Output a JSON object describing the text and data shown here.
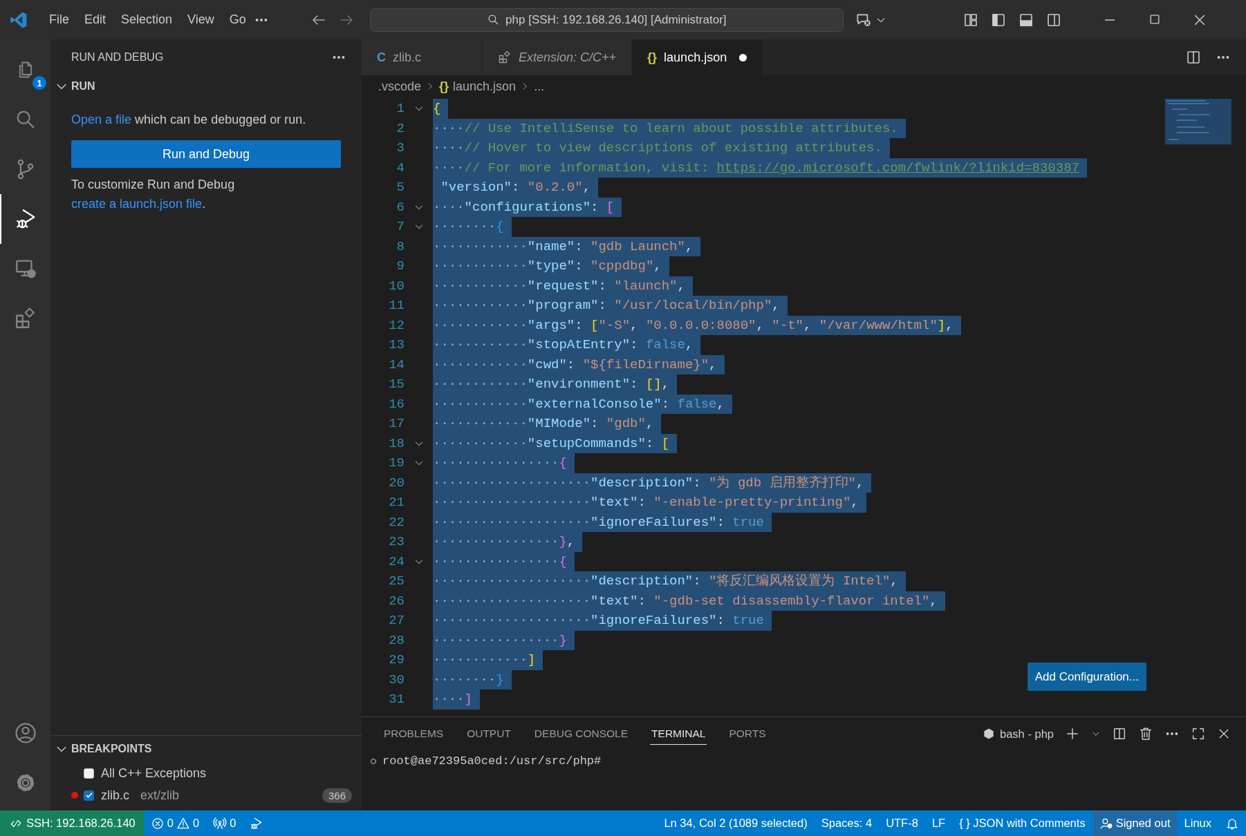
{
  "title_bar": {
    "menu": [
      "File",
      "Edit",
      "Selection",
      "View",
      "Go"
    ],
    "command_center": "php [SSH: 192.168.26.140] [Administrator]"
  },
  "activity_bar": {
    "items": [
      {
        "kind": "files",
        "badge": "1",
        "selected": false
      },
      {
        "kind": "search",
        "selected": false
      },
      {
        "kind": "source_control",
        "selected": false
      },
      {
        "kind": "run_debug",
        "selected": true
      },
      {
        "kind": "remote",
        "selected": false
      },
      {
        "kind": "extensions",
        "selected": false
      }
    ],
    "bottom": [
      {
        "kind": "account"
      },
      {
        "kind": "settings"
      }
    ]
  },
  "sidebar": {
    "title": "RUN AND DEBUG",
    "run_section": {
      "title": "RUN",
      "expanded": true,
      "intro_link": "Open a file",
      "intro_text": " which can be debugged or run.",
      "button": "Run and Debug",
      "customize_text": "To customize Run and Debug ",
      "customize_link": "create a launch.json file",
      "customize_end": "."
    },
    "breakpoints": {
      "title": "BREAKPOINTS",
      "expanded": true,
      "items": [
        {
          "kind": "exception",
          "label": "All C++ Exceptions",
          "checked": false
        },
        {
          "kind": "file",
          "label": "zlib.c",
          "path": "ext/zlib",
          "count": "366",
          "checked": true
        }
      ]
    }
  },
  "editor": {
    "tabs": [
      {
        "kind": "file",
        "glyph": "C",
        "label": "zlib.c",
        "selected": false,
        "modified": false
      },
      {
        "kind": "extension",
        "label": "Extension: C/C++",
        "selected": false,
        "modified": false
      },
      {
        "kind": "file",
        "glyph": "{}",
        "label": "launch.json",
        "selected": true,
        "modified": true
      }
    ],
    "breadcrumb": {
      "folder": ".vscode",
      "file_glyph": "{}",
      "file": "launch.json",
      "symbol": "..."
    },
    "lines": [
      {
        "n": "1",
        "fold": true,
        "selected": true,
        "tokens": [
          {
            "kind": "b1",
            "t": "{"
          }
        ]
      },
      {
        "n": "2",
        "fold": false,
        "selected": true,
        "tokens": [
          {
            "kind": "ws",
            "t": "····"
          },
          {
            "kind": "cm",
            "t": "// Use IntelliSense to learn about possible attributes."
          }
        ]
      },
      {
        "n": "3",
        "fold": false,
        "selected": true,
        "tokens": [
          {
            "kind": "ws",
            "t": "····"
          },
          {
            "kind": "cm",
            "t": "// Hover to view descriptions of existing attributes."
          }
        ]
      },
      {
        "n": "4",
        "fold": false,
        "selected": true,
        "tokens": [
          {
            "kind": "ws",
            "t": "····"
          },
          {
            "kind": "cm",
            "t": "// For more information, visit: "
          },
          {
            "kind": "link",
            "t": "https://go.microsoft.com/fwlink/?linkid=830387"
          }
        ]
      },
      {
        "n": "5",
        "fold": false,
        "selected": true,
        "tokens": [
          {
            "kind": "key",
            "t": " \"version\""
          },
          {
            "kind": "p",
            "t": ": "
          },
          {
            "kind": "str",
            "t": "\"0.2.0\""
          },
          {
            "kind": "p",
            "t": ","
          }
        ]
      },
      {
        "n": "6",
        "fold": true,
        "selected": true,
        "tokens": [
          {
            "kind": "ws",
            "t": "····"
          },
          {
            "kind": "key",
            "t": "\"configurations\""
          },
          {
            "kind": "p",
            "t": ": "
          },
          {
            "kind": "b2",
            "t": "["
          }
        ]
      },
      {
        "n": "7",
        "fold": true,
        "selected": true,
        "tokens": [
          {
            "kind": "ws",
            "t": "········"
          },
          {
            "kind": "b3",
            "t": "{"
          }
        ]
      },
      {
        "n": "8",
        "fold": false,
        "selected": true,
        "tokens": [
          {
            "kind": "ws",
            "t": "············"
          },
          {
            "kind": "key",
            "t": "\"name\""
          },
          {
            "kind": "p",
            "t": ": "
          },
          {
            "kind": "str",
            "t": "\"gdb Launch\""
          },
          {
            "kind": "p",
            "t": ","
          }
        ]
      },
      {
        "n": "9",
        "fold": false,
        "selected": true,
        "tokens": [
          {
            "kind": "ws",
            "t": "············"
          },
          {
            "kind": "key",
            "t": "\"type\""
          },
          {
            "kind": "p",
            "t": ": "
          },
          {
            "kind": "str",
            "t": "\"cppdbg\""
          },
          {
            "kind": "p",
            "t": ","
          }
        ]
      },
      {
        "n": "10",
        "fold": false,
        "selected": true,
        "tokens": [
          {
            "kind": "ws",
            "t": "············"
          },
          {
            "kind": "key",
            "t": "\"request\""
          },
          {
            "kind": "p",
            "t": ": "
          },
          {
            "kind": "str",
            "t": "\"launch\""
          },
          {
            "kind": "p",
            "t": ","
          }
        ]
      },
      {
        "n": "11",
        "fold": false,
        "selected": true,
        "tokens": [
          {
            "kind": "ws",
            "t": "············"
          },
          {
            "kind": "key",
            "t": "\"program\""
          },
          {
            "kind": "p",
            "t": ": "
          },
          {
            "kind": "str",
            "t": "\"/usr/local/bin/php\""
          },
          {
            "kind": "p",
            "t": ","
          }
        ]
      },
      {
        "n": "12",
        "fold": false,
        "selected": true,
        "tokens": [
          {
            "kind": "ws",
            "t": "············"
          },
          {
            "kind": "key",
            "t": "\"args\""
          },
          {
            "kind": "p",
            "t": ": "
          },
          {
            "kind": "b1",
            "t": "["
          },
          {
            "kind": "str",
            "t": "\"-S\""
          },
          {
            "kind": "p",
            "t": ", "
          },
          {
            "kind": "str",
            "t": "\"0.0.0.0:8080\""
          },
          {
            "kind": "p",
            "t": ", "
          },
          {
            "kind": "str",
            "t": "\"-t\""
          },
          {
            "kind": "p",
            "t": ", "
          },
          {
            "kind": "str",
            "t": "\"/var/www/html\""
          },
          {
            "kind": "b1",
            "t": "]"
          },
          {
            "kind": "p",
            "t": ","
          }
        ]
      },
      {
        "n": "13",
        "fold": false,
        "selected": true,
        "tokens": [
          {
            "kind": "ws",
            "t": "············"
          },
          {
            "kind": "key",
            "t": "\"stopAtEntry\""
          },
          {
            "kind": "p",
            "t": ": "
          },
          {
            "kind": "kw",
            "t": "false"
          },
          {
            "kind": "p",
            "t": ","
          }
        ]
      },
      {
        "n": "14",
        "fold": false,
        "selected": true,
        "tokens": [
          {
            "kind": "ws",
            "t": "············"
          },
          {
            "kind": "key",
            "t": "\"cwd\""
          },
          {
            "kind": "p",
            "t": ": "
          },
          {
            "kind": "str",
            "t": "\"${fileDirname}\""
          },
          {
            "kind": "p",
            "t": ","
          }
        ]
      },
      {
        "n": "15",
        "fold": false,
        "selected": true,
        "tokens": [
          {
            "kind": "ws",
            "t": "············"
          },
          {
            "kind": "key",
            "t": "\"environment\""
          },
          {
            "kind": "p",
            "t": ": "
          },
          {
            "kind": "b1",
            "t": "[]"
          },
          {
            "kind": "p",
            "t": ","
          }
        ]
      },
      {
        "n": "16",
        "fold": false,
        "selected": true,
        "tokens": [
          {
            "kind": "ws",
            "t": "············"
          },
          {
            "kind": "key",
            "t": "\"externalConsole\""
          },
          {
            "kind": "p",
            "t": ": "
          },
          {
            "kind": "kw",
            "t": "false"
          },
          {
            "kind": "p",
            "t": ","
          }
        ]
      },
      {
        "n": "17",
        "fold": false,
        "selected": true,
        "tokens": [
          {
            "kind": "ws",
            "t": "············"
          },
          {
            "kind": "key",
            "t": "\"MIMode\""
          },
          {
            "kind": "p",
            "t": ": "
          },
          {
            "kind": "str",
            "t": "\"gdb\""
          },
          {
            "kind": "p",
            "t": ","
          }
        ]
      },
      {
        "n": "18",
        "fold": true,
        "selected": true,
        "tokens": [
          {
            "kind": "ws",
            "t": "············"
          },
          {
            "kind": "key",
            "t": "\"setupCommands\""
          },
          {
            "kind": "p",
            "t": ": "
          },
          {
            "kind": "b1",
            "t": "["
          }
        ]
      },
      {
        "n": "19",
        "fold": true,
        "selected": true,
        "tokens": [
          {
            "kind": "ws",
            "t": "················"
          },
          {
            "kind": "b2",
            "t": "{"
          }
        ]
      },
      {
        "n": "20",
        "fold": false,
        "selected": true,
        "tokens": [
          {
            "kind": "ws",
            "t": "····················"
          },
          {
            "kind": "key",
            "t": "\"description\""
          },
          {
            "kind": "p",
            "t": ": "
          },
          {
            "kind": "str",
            "t": "\"为 gdb 启用整齐打印\""
          },
          {
            "kind": "p",
            "t": ","
          }
        ]
      },
      {
        "n": "21",
        "fold": false,
        "selected": true,
        "tokens": [
          {
            "kind": "ws",
            "t": "····················"
          },
          {
            "kind": "key",
            "t": "\"text\""
          },
          {
            "kind": "p",
            "t": ": "
          },
          {
            "kind": "str",
            "t": "\"-enable-pretty-printing\""
          },
          {
            "kind": "p",
            "t": ","
          }
        ]
      },
      {
        "n": "22",
        "fold": false,
        "selected": true,
        "tokens": [
          {
            "kind": "ws",
            "t": "····················"
          },
          {
            "kind": "key",
            "t": "\"ignoreFailures\""
          },
          {
            "kind": "p",
            "t": ": "
          },
          {
            "kind": "kw",
            "t": "true"
          }
        ]
      },
      {
        "n": "23",
        "fold": false,
        "selected": true,
        "tokens": [
          {
            "kind": "ws",
            "t": "················"
          },
          {
            "kind": "b2",
            "t": "}"
          },
          {
            "kind": "p",
            "t": ","
          }
        ]
      },
      {
        "n": "24",
        "fold": true,
        "selected": true,
        "tokens": [
          {
            "kind": "ws",
            "t": "················"
          },
          {
            "kind": "b2",
            "t": "{"
          }
        ]
      },
      {
        "n": "25",
        "fold": false,
        "selected": true,
        "tokens": [
          {
            "kind": "ws",
            "t": "····················"
          },
          {
            "kind": "key",
            "t": "\"description\""
          },
          {
            "kind": "p",
            "t": ": "
          },
          {
            "kind": "str",
            "t": "\"将反汇编风格设置为 Intel\""
          },
          {
            "kind": "p",
            "t": ","
          }
        ]
      },
      {
        "n": "26",
        "fold": false,
        "selected": true,
        "tokens": [
          {
            "kind": "ws",
            "t": "····················"
          },
          {
            "kind": "key",
            "t": "\"text\""
          },
          {
            "kind": "p",
            "t": ": "
          },
          {
            "kind": "str",
            "t": "\"-gdb-set disassembly-flavor intel\""
          },
          {
            "kind": "p",
            "t": ","
          }
        ]
      },
      {
        "n": "27",
        "fold": false,
        "selected": true,
        "tokens": [
          {
            "kind": "ws",
            "t": "····················"
          },
          {
            "kind": "key",
            "t": "\"ignoreFailures\""
          },
          {
            "kind": "p",
            "t": ": "
          },
          {
            "kind": "kw",
            "t": "true"
          }
        ]
      },
      {
        "n": "28",
        "fold": false,
        "selected": true,
        "tokens": [
          {
            "kind": "ws",
            "t": "················"
          },
          {
            "kind": "b2",
            "t": "}"
          }
        ]
      },
      {
        "n": "29",
        "fold": false,
        "selected": true,
        "tokens": [
          {
            "kind": "ws",
            "t": "············"
          },
          {
            "kind": "b1",
            "t": "]"
          }
        ]
      },
      {
        "n": "30",
        "fold": false,
        "selected": true,
        "tokens": [
          {
            "kind": "ws",
            "t": "········"
          },
          {
            "kind": "b3",
            "t": "}"
          }
        ]
      },
      {
        "n": "31",
        "fold": false,
        "selected": true,
        "tokens": [
          {
            "kind": "ws",
            "t": "····"
          },
          {
            "kind": "b2",
            "t": "]"
          }
        ]
      }
    ],
    "add_configuration": "Add Configuration..."
  },
  "panel": {
    "tabs": [
      {
        "label": "PROBLEMS",
        "selected": false
      },
      {
        "label": "OUTPUT",
        "selected": false
      },
      {
        "label": "DEBUG CONSOLE",
        "selected": false
      },
      {
        "label": "TERMINAL",
        "selected": true
      },
      {
        "label": "PORTS",
        "selected": false
      }
    ],
    "terminal_name": "bash - php",
    "prompt": "root@ae72395a0ced:/usr/src/php#"
  },
  "status_bar": {
    "remote": "SSH: 192.168.26.140",
    "errors": "0",
    "warnings": "0",
    "ports": "0",
    "right": [
      {
        "kind": "text",
        "text": "Ln 34, Col 2 (1089 selected)"
      },
      {
        "kind": "text",
        "text": "Spaces: 4"
      },
      {
        "kind": "text",
        "text": "UTF-8"
      },
      {
        "kind": "text",
        "text": "LF"
      },
      {
        "kind": "language",
        "glyph": "{ }",
        "text": "JSON with Comments"
      },
      {
        "kind": "account",
        "text": "Signed out"
      },
      {
        "kind": "text",
        "text": "Linux"
      },
      {
        "kind": "bell"
      }
    ]
  }
}
